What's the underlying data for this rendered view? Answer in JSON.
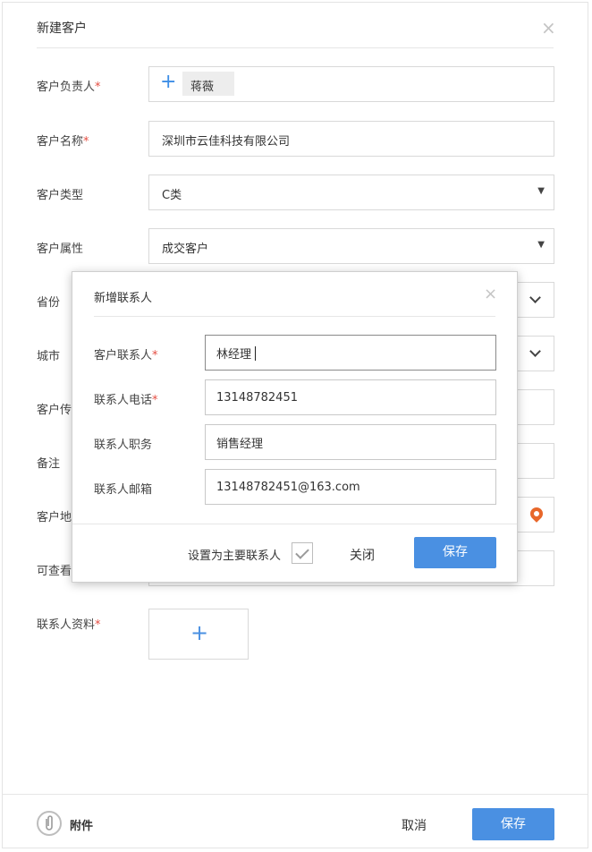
{
  "dialog": {
    "title": "新建客户",
    "close_icon": "close-icon"
  },
  "form": {
    "owner": {
      "label": "客户负责人",
      "required": "*",
      "chip": "蒋薇"
    },
    "name": {
      "label": "客户名称",
      "required": "*",
      "value": "深圳市云佳科技有限公司"
    },
    "type": {
      "label": "客户类型",
      "value": "C类"
    },
    "attribute": {
      "label": "客户属性",
      "value": "成交客户"
    },
    "province": {
      "label": "省份"
    },
    "city": {
      "label": "城市"
    },
    "fax": {
      "label": "客户传"
    },
    "note": {
      "label": "备注"
    },
    "address": {
      "label": "客户地"
    },
    "viewer": {
      "label": "可查看"
    },
    "contact_files": {
      "label": "联系人资料",
      "required": "*"
    }
  },
  "footer": {
    "attach_label": "附件",
    "cancel_label": "取消",
    "save_label": "保存"
  },
  "modal": {
    "title": "新增联系人",
    "fields": {
      "contact": {
        "label": "客户联系人",
        "required": "*",
        "value": "林经理"
      },
      "phone": {
        "label": "联系人电话",
        "required": "*",
        "value": "13148782451"
      },
      "position": {
        "label": "联系人职务",
        "value": "销售经理"
      },
      "email": {
        "label": "联系人邮箱",
        "value": "13148782451@163.com"
      }
    },
    "primary_label": "设置为主要联系人",
    "close_label": "关闭",
    "save_label": "保存"
  },
  "colors": {
    "accent": "#4a90e2",
    "required": "#e54d42",
    "location_pin": "#e8672a"
  }
}
